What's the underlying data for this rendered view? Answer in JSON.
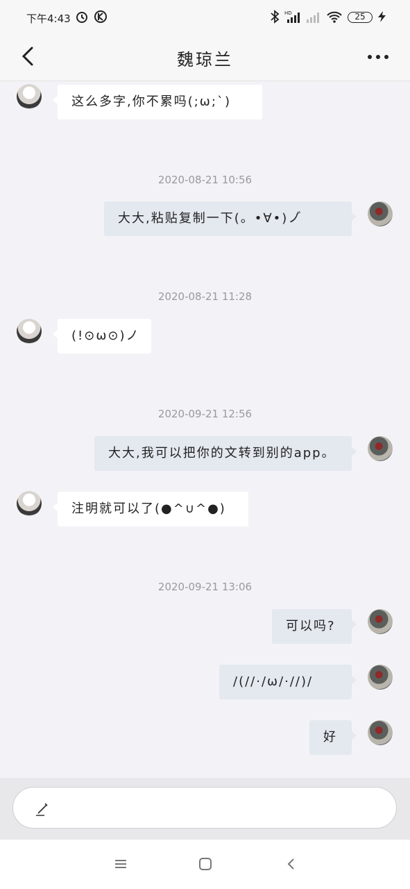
{
  "status_bar": {
    "time": "下午4:43",
    "battery": "25",
    "icons": [
      "alarm-icon",
      "k-app-icon",
      "bluetooth-icon",
      "hd-signal-icon",
      "signal-icon",
      "wifi-icon",
      "battery-icon",
      "charging-icon"
    ]
  },
  "header": {
    "title": "魏琼兰",
    "back_icon": "chevron-left-icon",
    "more_icon": "more-horizontal-icon"
  },
  "messages": [
    {
      "side": "left",
      "text": "这么多字,你不累吗(;ω;`)"
    },
    {
      "type": "timestamp",
      "text": "2020-08-21 10:56"
    },
    {
      "side": "right",
      "text": "大大,粘贴复制一下(。•∀•)ノ゙"
    },
    {
      "type": "timestamp",
      "text": "2020-08-21 11:28"
    },
    {
      "side": "left",
      "text": "(!⊙ω⊙)ノ"
    },
    {
      "type": "timestamp",
      "text": "2020-09-21 12:56"
    },
    {
      "side": "right",
      "text": "大大,我可以把你的文转到别的app。"
    },
    {
      "side": "left",
      "text": "注明就可以了(●^∪^●)"
    },
    {
      "type": "timestamp",
      "text": "2020-09-21 13:06"
    },
    {
      "side": "right",
      "text": "可以吗?"
    },
    {
      "side": "right",
      "text": "/(//·/ω/·//)/"
    },
    {
      "side": "right",
      "text": "好"
    }
  ],
  "input": {
    "placeholder": "",
    "icon": "pen-icon"
  },
  "system_nav": [
    "menu-icon",
    "home-icon",
    "back-icon"
  ],
  "colors": {
    "background": "#f3f3f7",
    "bubble_self": "#e4e8ef",
    "bubble_other": "#ffffff",
    "timestamp": "#9a9a9a"
  }
}
